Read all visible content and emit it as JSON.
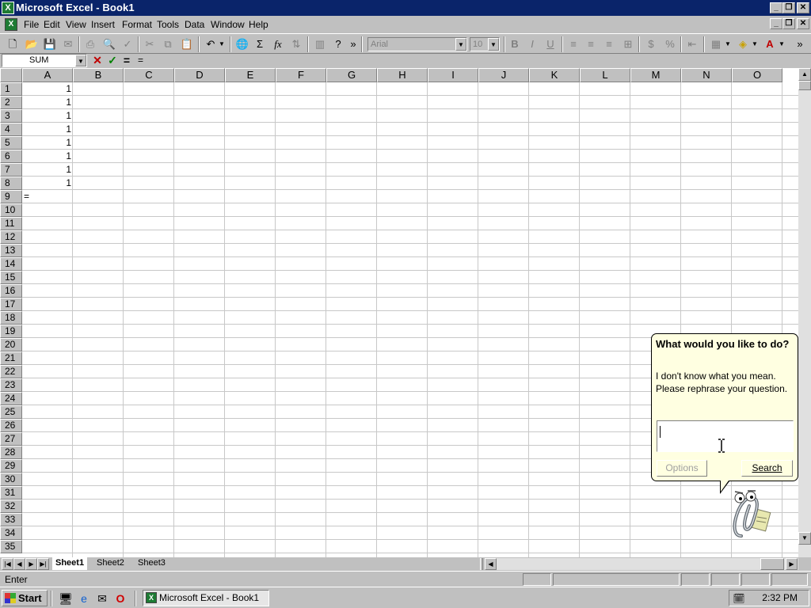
{
  "window": {
    "title": "Microsoft Excel - Book1",
    "app_icon": "excel-icon",
    "caption_buttons": [
      "minimize",
      "restore",
      "close"
    ]
  },
  "menubar": {
    "items": [
      {
        "label": "File",
        "key": "F"
      },
      {
        "label": "Edit",
        "key": "E"
      },
      {
        "label": "View",
        "key": "V"
      },
      {
        "label": "Insert",
        "key": "I"
      },
      {
        "label": "Format",
        "key": "o"
      },
      {
        "label": "Tools",
        "key": "T"
      },
      {
        "label": "Data",
        "key": "D"
      },
      {
        "label": "Window",
        "key": "W"
      },
      {
        "label": "Help",
        "key": "H"
      }
    ]
  },
  "toolbar": {
    "font_name": "Arial",
    "font_size": "10",
    "bold_label": "B",
    "italic_label": "I",
    "underline_label": "U",
    "autosum_label": "Σ",
    "function_label": "fx",
    "percent_label": "%",
    "currency_label": "$"
  },
  "formula_bar": {
    "name_box": "SUM",
    "cancel_label": "✕",
    "enter_label": "✓",
    "edit_formula_label": "=",
    "contents": "="
  },
  "grid": {
    "columns": [
      "A",
      "B",
      "C",
      "D",
      "E",
      "F",
      "G",
      "H",
      "I",
      "J",
      "K",
      "L",
      "M",
      "N",
      "O"
    ],
    "rows": [
      "1",
      "2",
      "3",
      "4",
      "5",
      "6",
      "7",
      "8",
      "9",
      "10",
      "11",
      "12",
      "13",
      "14",
      "15",
      "16",
      "17",
      "18",
      "19",
      "20",
      "21",
      "22",
      "23",
      "24",
      "25",
      "26",
      "27",
      "28",
      "29",
      "30",
      "31",
      "32",
      "33",
      "34",
      "35"
    ],
    "cells": {
      "A1": "1",
      "A2": "1",
      "A3": "1",
      "A4": "1",
      "A5": "1",
      "A6": "1",
      "A7": "1",
      "A8": "1",
      "A9": "="
    }
  },
  "sheets": {
    "tabs": [
      "Sheet1",
      "Sheet2",
      "Sheet3"
    ],
    "active": "Sheet1"
  },
  "statusbar": {
    "mode": "Enter"
  },
  "assistant": {
    "heading": "What would you like to do?",
    "message": "I don't know what you mean. Please rephrase your question.",
    "input_value": "",
    "options_label": "Options",
    "search_label": "Search"
  },
  "taskbar": {
    "start_label": "Start",
    "quick_launch": [
      "desktop-icon",
      "internet-explorer-icon",
      "outlook-express-icon",
      "opera-icon"
    ],
    "tasks": [
      {
        "label": "Microsoft Excel - Book1",
        "icon": "excel-icon"
      }
    ],
    "clock": "2:32 PM"
  }
}
